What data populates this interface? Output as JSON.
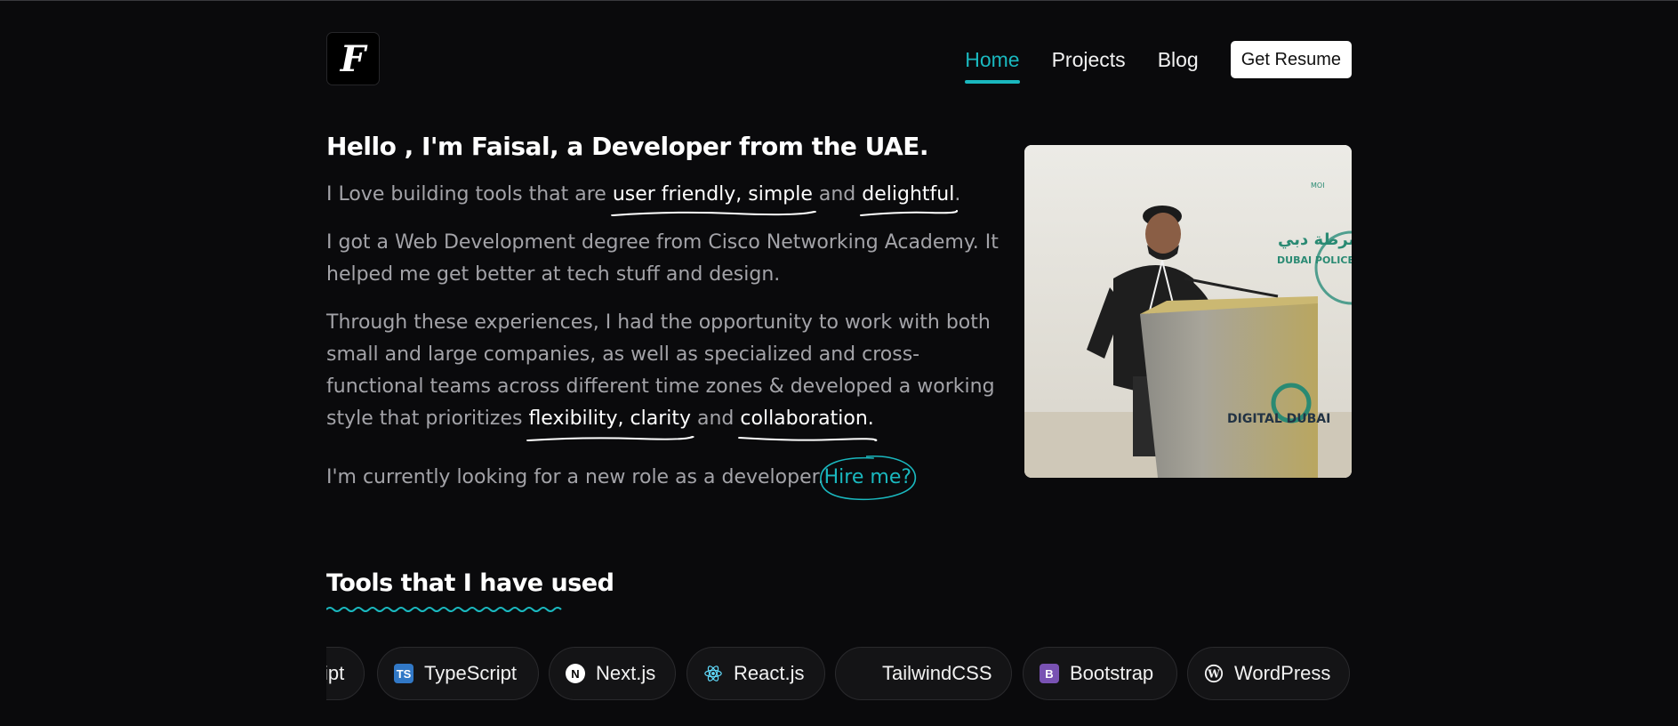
{
  "header": {
    "logo_letter": "F",
    "nav": [
      {
        "label": "Home",
        "active": true
      },
      {
        "label": "Projects",
        "active": false
      },
      {
        "label": "Blog",
        "active": false
      }
    ],
    "resume_button": "Get Resume"
  },
  "hero": {
    "headline": "Hello , I'm Faisal, a Developer from the UAE.",
    "p1": {
      "before": "I Love building tools that are ",
      "hl1": "user friendly, simple",
      "mid": " and ",
      "hl2": "delightful",
      "after": "."
    },
    "p2": "I got a Web Development degree from Cisco Networking Academy. It helped me get better at tech stuff and design.",
    "p3": {
      "lead": "Through these experiences, I had the opportunity to work with both small and large companies, as well as specialized and cross-functional teams across different time zones & developed a working style that prioritizes ",
      "hl1": "flexibility, clarity",
      "mid": " and ",
      "hl2": "collaboration."
    },
    "p4": {
      "text": "I'm currently looking for a new role as a developer.",
      "link": "Hire me?"
    }
  },
  "photo": {
    "logo_text_1": "DUBAI POLICE",
    "logo_text_2": "DIGITAL DUBAI"
  },
  "tools": {
    "title": "Tools that I have used",
    "items": [
      {
        "label": "ipt",
        "icon": "javascript-icon"
      },
      {
        "label": "TypeScript",
        "icon": "typescript-icon"
      },
      {
        "label": "Next.js",
        "icon": "nextjs-icon"
      },
      {
        "label": "React.js",
        "icon": "react-icon"
      },
      {
        "label": "TailwindCSS",
        "icon": "tailwind-icon"
      },
      {
        "label": "Bootstrap",
        "icon": "bootstrap-icon"
      },
      {
        "label": "WordPress",
        "icon": "wordpress-icon"
      }
    ]
  },
  "colors": {
    "accent": "#1ab8bf",
    "background": "#0a0a0c",
    "text": "#a3a3a8",
    "heading": "#ffffff"
  }
}
